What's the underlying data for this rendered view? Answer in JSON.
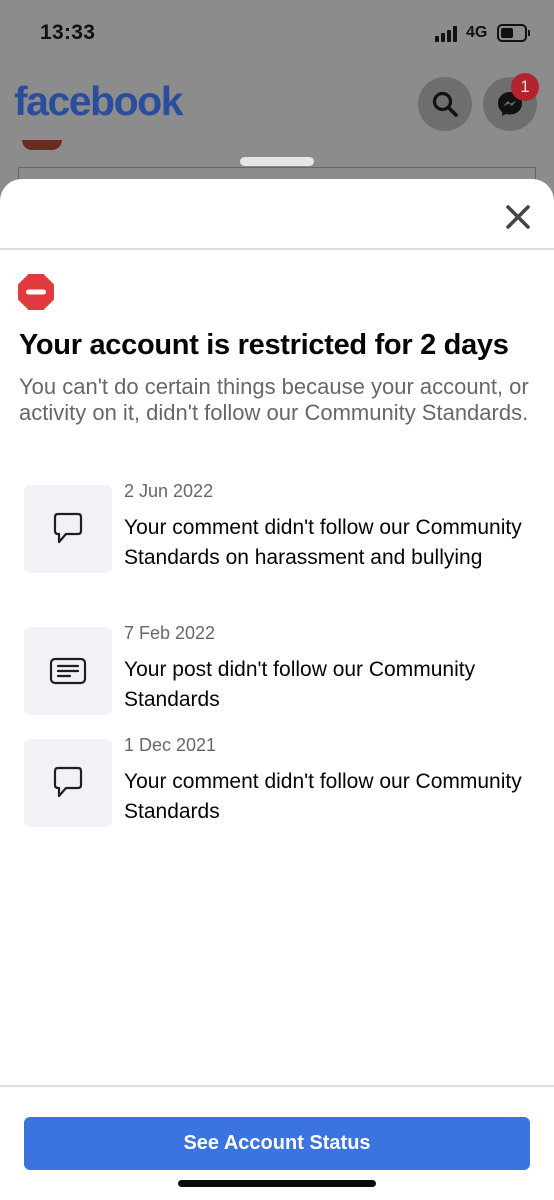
{
  "status_bar": {
    "time": "13:33",
    "network": "4G"
  },
  "app": {
    "logo": "facebook",
    "search_icon": "search-icon",
    "messenger_icon": "messenger-icon",
    "messenger_badge": "1"
  },
  "sheet": {
    "close_icon": "close-icon",
    "restriction_icon": "no-entry-icon",
    "title": "Your account is restricted for 2 days",
    "subtitle": "You can't do certain things because your account, or activity on it, didn't follow our Community Standards.",
    "violations": [
      {
        "icon": "comment-icon",
        "date": "2 Jun 2022",
        "text": "Your comment didn't follow our Community Standards on harassment and bullying"
      },
      {
        "icon": "post-icon",
        "date": "7 Feb 2022",
        "text": "Your post didn't follow our Community Standards"
      },
      {
        "icon": "comment-icon",
        "date": "1 Dec 2021",
        "text": "Your comment didn't follow our Community Standards"
      }
    ],
    "cta_label": "See Account Status"
  },
  "colors": {
    "brand_blue": "#3b73e0",
    "facebook_logo": "#2a4e9b",
    "restriction_red": "#e0393e",
    "badge_red": "#b3232b",
    "secondary_text": "#65676b"
  }
}
